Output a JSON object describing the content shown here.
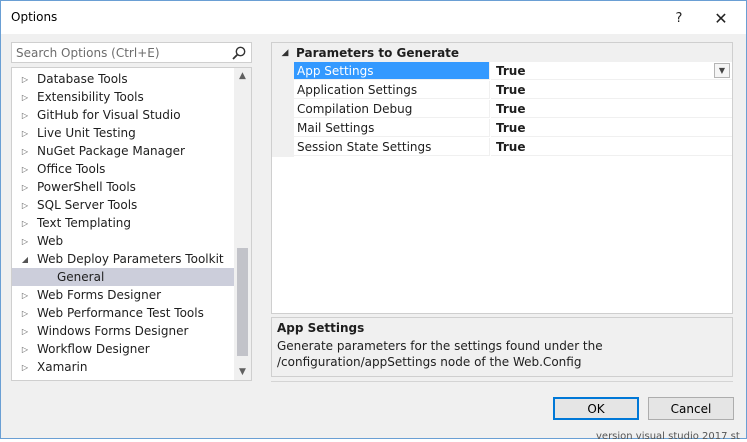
{
  "window": {
    "title": "Options",
    "help_glyph": "?",
    "close_glyph": "✕"
  },
  "search": {
    "placeholder": "Search Options (Ctrl+E)"
  },
  "tree": {
    "items": [
      {
        "label": "Database Tools",
        "expander": "▷"
      },
      {
        "label": "Extensibility Tools",
        "expander": "▷"
      },
      {
        "label": "GitHub for Visual Studio",
        "expander": "▷"
      },
      {
        "label": "Live Unit Testing",
        "expander": "▷"
      },
      {
        "label": "NuGet Package Manager",
        "expander": "▷"
      },
      {
        "label": "Office Tools",
        "expander": "▷"
      },
      {
        "label": "PowerShell Tools",
        "expander": "▷"
      },
      {
        "label": "SQL Server Tools",
        "expander": "▷"
      },
      {
        "label": "Text Templating",
        "expander": "▷"
      },
      {
        "label": "Web",
        "expander": "▷"
      },
      {
        "label": "Web Deploy Parameters Toolkit",
        "expander": "◢"
      },
      {
        "label": "General",
        "expander": ""
      },
      {
        "label": "Web Forms Designer",
        "expander": "▷"
      },
      {
        "label": "Web Performance Test Tools",
        "expander": "▷"
      },
      {
        "label": "Windows Forms Designer",
        "expander": "▷"
      },
      {
        "label": "Workflow Designer",
        "expander": "▷"
      },
      {
        "label": "Xamarin",
        "expander": "▷"
      }
    ],
    "scroll_up": "▲",
    "scroll_down": "▼"
  },
  "grid": {
    "category": "Parameters to Generate",
    "category_expander": "◢",
    "rows": [
      {
        "name": "App Settings",
        "value": "True"
      },
      {
        "name": "Application Settings",
        "value": "True"
      },
      {
        "name": "Compilation Debug",
        "value": "True"
      },
      {
        "name": "Mail Settings",
        "value": "True"
      },
      {
        "name": "Session State Settings",
        "value": "True"
      }
    ],
    "dropdown_glyph": "▼"
  },
  "description": {
    "title": "App Settings",
    "text": "Generate parameters for the settings found under the /configuration/appSettings node of the Web.Config"
  },
  "buttons": {
    "ok": "OK",
    "cancel": "Cancel"
  },
  "background_text": "version   visual studio 2017  st"
}
